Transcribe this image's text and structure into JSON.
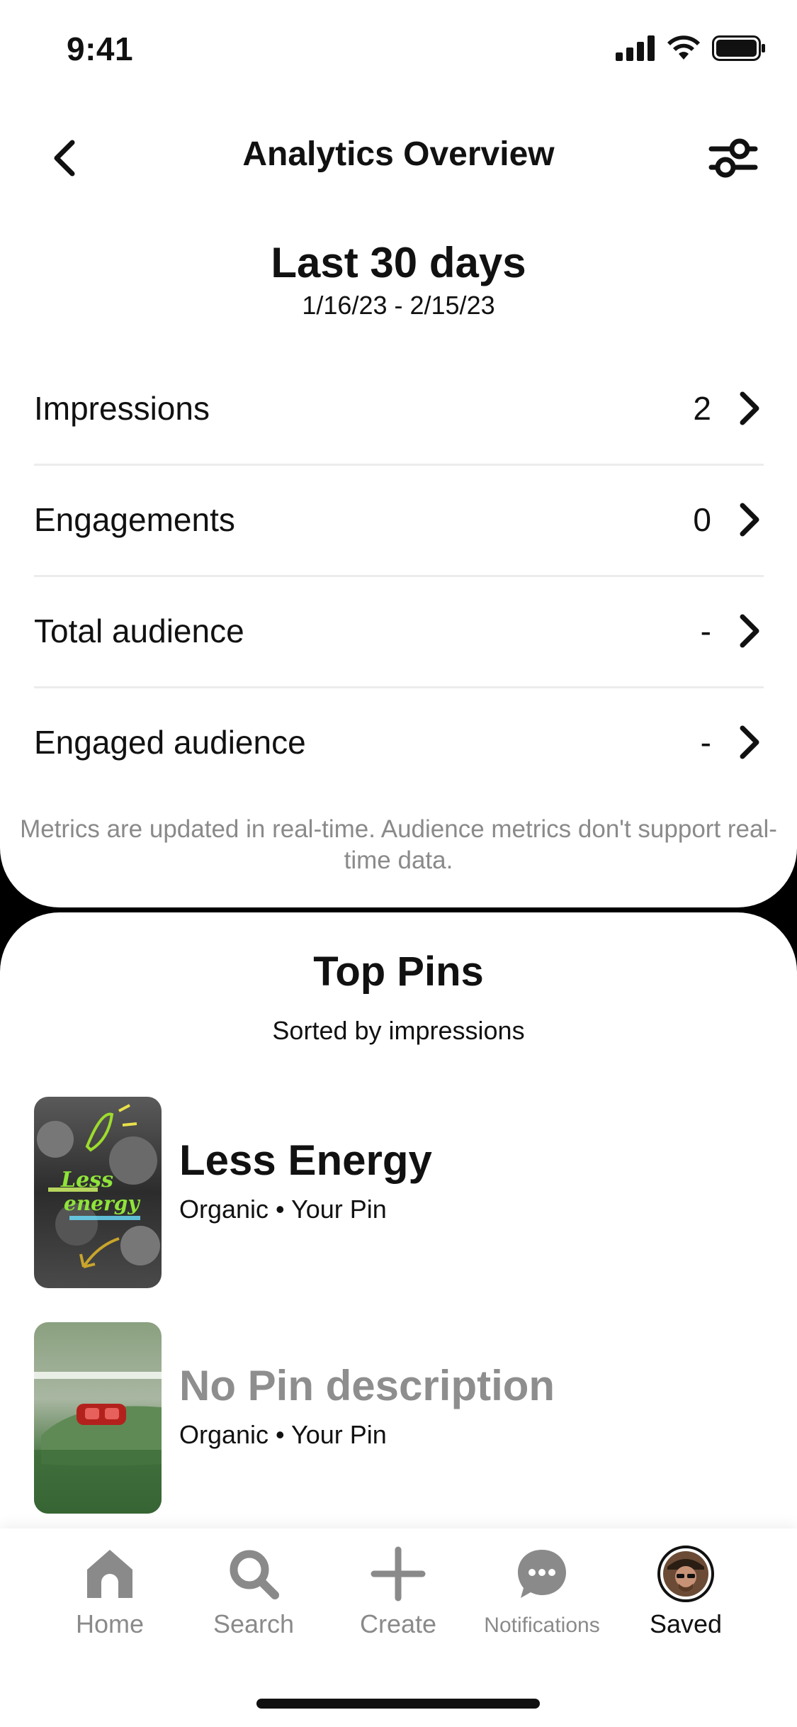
{
  "status": {
    "time": "9:41"
  },
  "header": {
    "title": "Analytics Overview"
  },
  "range": {
    "title": "Last 30 days",
    "dates": "1/16/23 - 2/15/23"
  },
  "metrics": [
    {
      "label": "Impressions",
      "value": "2"
    },
    {
      "label": "Engagements",
      "value": "0"
    },
    {
      "label": "Total audience",
      "value": "-"
    },
    {
      "label": "Engaged audience",
      "value": "-"
    }
  ],
  "note": "Metrics are updated in real-time. Audience metrics don't support real-time data.",
  "top_pins": {
    "title": "Top Pins",
    "subtitle": "Sorted by impressions",
    "pins": [
      {
        "title": "Less Energy",
        "meta": "Organic • Your Pin",
        "thumb_text_1": "Less",
        "thumb_text_2": "energy"
      },
      {
        "title": "No Pin description",
        "meta": "Organic • Your Pin"
      }
    ]
  },
  "nav": [
    {
      "label": "Home",
      "icon": "home-icon"
    },
    {
      "label": "Search",
      "icon": "search-icon"
    },
    {
      "label": "Create",
      "icon": "plus-icon"
    },
    {
      "label": "Notifications",
      "icon": "chat-icon"
    },
    {
      "label": "Saved",
      "icon": "avatar"
    }
  ],
  "colors": {
    "accent_text": "#111111",
    "muted": "#8a8a8a",
    "divider": "#ececec",
    "thumb_green": "#3d6b3e"
  }
}
